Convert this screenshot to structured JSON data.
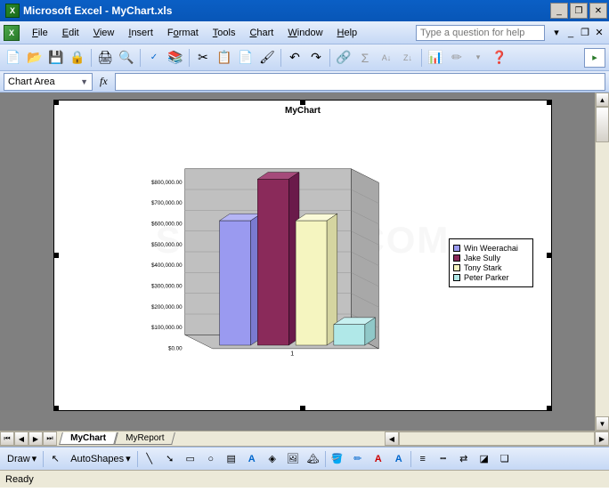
{
  "window": {
    "app_name": "Microsoft Excel",
    "document": "MyChart.xls",
    "title": "Microsoft Excel - MyChart.xls"
  },
  "menu": {
    "items": [
      "File",
      "Edit",
      "View",
      "Insert",
      "Format",
      "Tools",
      "Chart",
      "Window",
      "Help"
    ],
    "help_placeholder": "Type a question for help"
  },
  "namebox": {
    "value": "Chart Area",
    "fx": "fx"
  },
  "tabs": {
    "nav": [
      "⏮",
      "◀",
      "▶",
      "⏭"
    ],
    "items": [
      {
        "label": "MyChart",
        "active": true
      },
      {
        "label": "MyReport",
        "active": false
      }
    ]
  },
  "drawbar": {
    "draw_label": "Draw",
    "autoshapes_label": "AutoShapes"
  },
  "status": {
    "text": "Ready"
  },
  "chart_data": {
    "type": "bar",
    "title": "MyChart",
    "categories": [
      "1"
    ],
    "series": [
      {
        "name": "Win Weerachai",
        "values": [
          600000
        ],
        "color": "#9a9af0"
      },
      {
        "name": "Jake Sully",
        "values": [
          800000
        ],
        "color": "#8a2a5a"
      },
      {
        "name": "Tony Stark",
        "values": [
          600000
        ],
        "color": "#f5f5c0"
      },
      {
        "name": "Peter Parker",
        "values": [
          100000
        ],
        "color": "#b0e8e8"
      }
    ],
    "ylabel": "",
    "xlabel": "",
    "ylim": [
      0,
      800000
    ],
    "ytick_format": "$#,##0.00",
    "yticks": [
      "$0.00",
      "$100,000.00",
      "$200,000.00",
      "$300,000.00",
      "$400,000.00",
      "$500,000.00",
      "$600,000.00",
      "$700,000.00",
      "$800,000.00"
    ],
    "style_3d": true
  },
  "watermark": "SHOTDEV.COM"
}
